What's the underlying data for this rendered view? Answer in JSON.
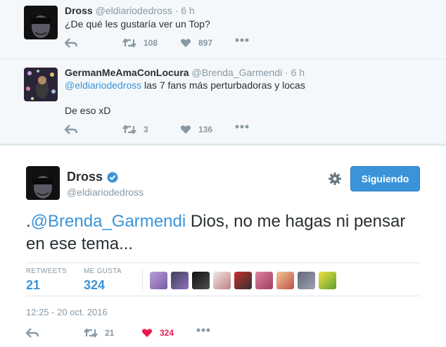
{
  "tweet1": {
    "name": "Dross",
    "handle": "@eldiariodedross",
    "dot": "·",
    "time": "6 h",
    "text": "¿De qué les gustaría ver un Top?",
    "retweets": "108",
    "likes": "897"
  },
  "tweet2": {
    "name": "GermanMeAmaConLocura",
    "handle": "@Brenda_Garmendi",
    "dot": "·",
    "time": "6 h",
    "mention": "@eldiariodedross",
    "text_rest": " las 7 fans más perturbadoras y locas",
    "text_line2": "De eso xD",
    "retweets": "3",
    "likes": "136"
  },
  "main": {
    "name": "Dross",
    "handle": "@eldiariodedross",
    "follow_label": "Siguiendo",
    "text_prefix": ".",
    "mention": "@Brenda_Garmendi",
    "text_rest": " Dios, no me hagas ni pensar en ese tema...",
    "retweets_label": "RETWEETS",
    "retweets": "21",
    "likes_label": "ME GUSTA",
    "likes": "324",
    "date": "12:25 - 20 oct. 2016",
    "action_retweets": "21",
    "action_likes": "324"
  },
  "colors": {
    "accent": "#3b94d9",
    "like": "#e81c4f",
    "muted": "#8899a6",
    "context_bg": "#f5f8fa"
  },
  "icons": [
    "reply-icon",
    "retweet-icon",
    "heart-icon",
    "more-icon",
    "verified-icon",
    "gear-icon"
  ]
}
